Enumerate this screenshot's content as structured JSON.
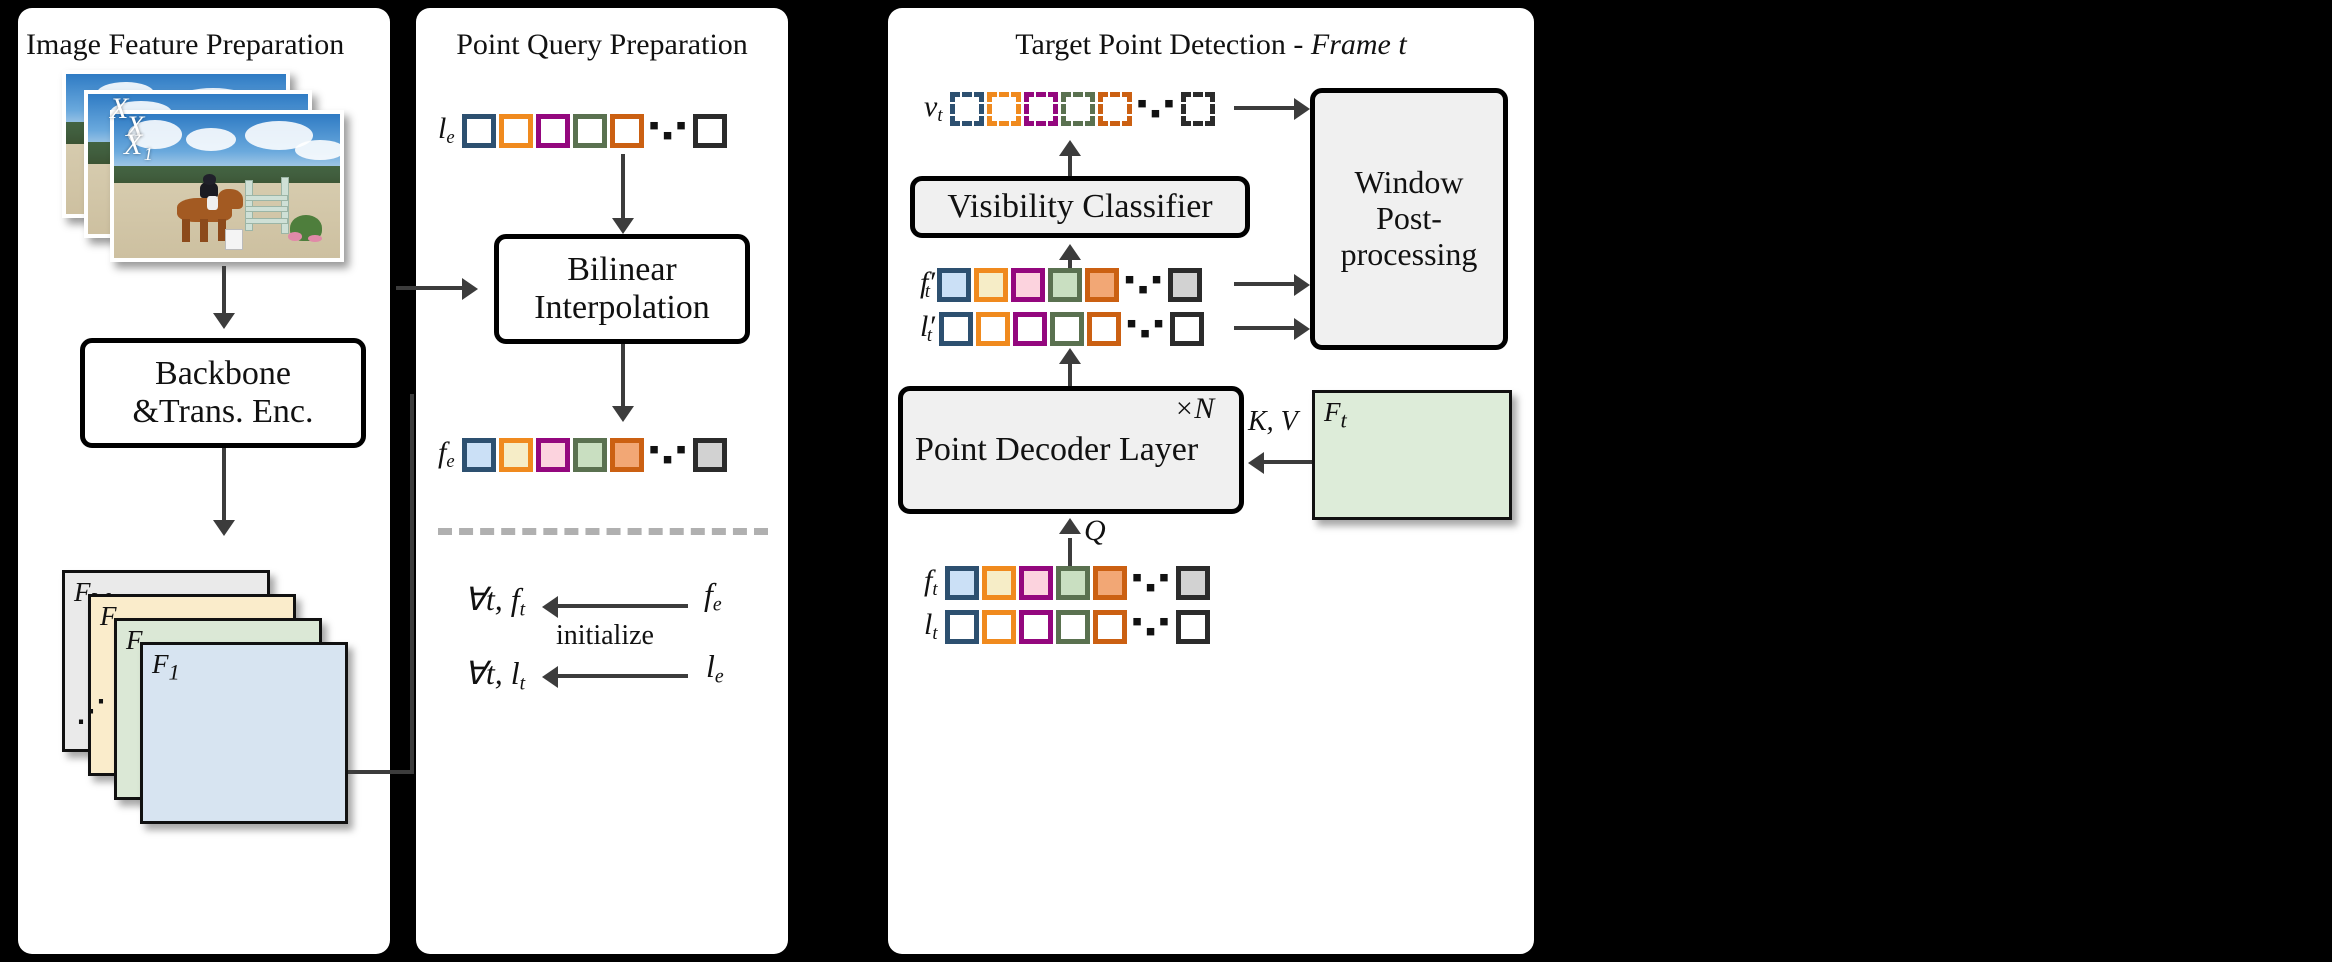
{
  "panels": {
    "image_feature": {
      "title": "Image Feature Preparation",
      "photo_labels": [
        "X",
        "X",
        "X₁"
      ],
      "backbone_line1": "Backbone",
      "backbone_line2": "&Trans. Enc.",
      "feature_maps": [
        "F_W",
        "F",
        "F",
        "F₁"
      ],
      "feature_map_labels": {
        "first": "F",
        "first_sub": "1",
        "last": "F",
        "last_sub": "W",
        "ellipsis": "⋯"
      }
    },
    "point_query": {
      "title": "Point Query Preparation",
      "le_label": "l",
      "le_sub": "e",
      "bilinear_line1": "Bilinear",
      "bilinear_line2": "Interpolation",
      "fe_label": "f",
      "fe_sub": "e",
      "ellipsis": "▪ ▪ ▪",
      "init": {
        "row1_left": "∀t, f",
        "row1_left_sub": "t",
        "row1_right": "f",
        "row1_right_sub": "e",
        "row2_left": "∀t, l",
        "row2_left_sub": "t",
        "row2_right": "l",
        "row2_right_sub": "e",
        "arrow_label": "initialize"
      }
    },
    "target_detection": {
      "title_plain": "Target Point Detection - ",
      "title_italic": "Frame t",
      "vt_label": "v",
      "vt_sub": "t",
      "visibility_classifier": "Visibility Classifier",
      "window_post_line1": "Window",
      "window_post_line2": "Post-processing",
      "ftp_label": "f",
      "ftp_sub": "t",
      "ftp_prime": "′",
      "ltp_label": "l",
      "ltp_sub": "t",
      "ltp_prime": "′",
      "decoder_label": "Point Decoder Layer",
      "decoder_repeat": "×N",
      "kv_label": "K, V",
      "q_label": "Q",
      "ft_feature_label": "F",
      "ft_feature_sub": "t",
      "ft_label": "f",
      "ft_sub": "t",
      "lt_label": "l",
      "lt_sub": "t"
    }
  },
  "token_colors": {
    "borders": [
      "#2d5070",
      "#f08a1e",
      "#94077e",
      "#5a7150",
      "#cb6012"
    ],
    "fills": [
      "#cbe0f6",
      "#f6edc7",
      "#fcd3de",
      "#c9dfc1",
      "#f2a775"
    ],
    "last_border": "#2b2b2b",
    "last_fill_gray": "#d2d2d2",
    "last_fill_white": "#ffffff"
  },
  "accents": {
    "arrow": "#3c3c3c",
    "box_border": "#000000",
    "box_gray_fill": "#f0f0f0",
    "feature_map_colors": [
      "#eaeaea",
      "#faeccb",
      "#dbe8d6",
      "#d7e4f1"
    ],
    "ft_map_fill": "#ddecd9",
    "separator": "#b0b0b0",
    "panel_bg": "#ffffff",
    "page_bg": "#000000"
  },
  "token_counts": {
    "visible": 5,
    "has_ellipsis": true,
    "has_trailing": true
  }
}
